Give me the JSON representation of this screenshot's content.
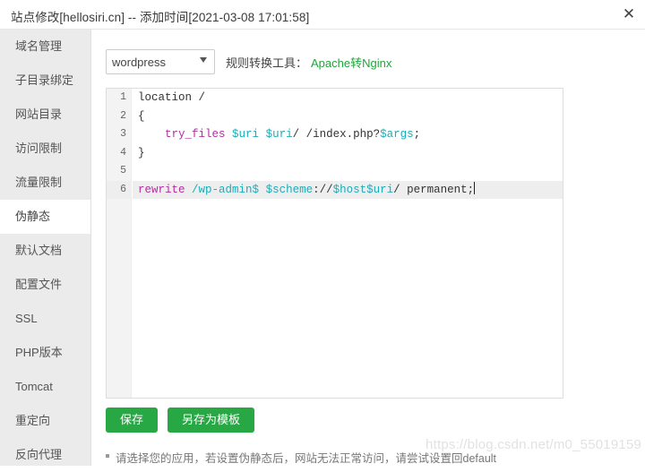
{
  "window": {
    "title": "站点修改[hellosiri.cn] -- 添加时间[2021-03-08 17:01:58]",
    "close_label": "✕"
  },
  "sidebar": {
    "items": [
      {
        "label": "域名管理",
        "active": false
      },
      {
        "label": "子目录绑定",
        "active": false
      },
      {
        "label": "网站目录",
        "active": false
      },
      {
        "label": "访问限制",
        "active": false
      },
      {
        "label": "流量限制",
        "active": false
      },
      {
        "label": "伪静态",
        "active": true
      },
      {
        "label": "默认文档",
        "active": false
      },
      {
        "label": "配置文件",
        "active": false
      },
      {
        "label": "SSL",
        "active": false
      },
      {
        "label": "PHP版本",
        "active": false
      },
      {
        "label": "Tomcat",
        "active": false
      },
      {
        "label": "重定向",
        "active": false
      },
      {
        "label": "反向代理",
        "active": false
      }
    ]
  },
  "toolbar": {
    "select_value": "wordpress",
    "select_options": [
      "wordpress"
    ],
    "converter_label": "规则转换工具：",
    "converter_link": "Apache转Nginx",
    "link_color": "#20a53a"
  },
  "editor": {
    "lines": [
      {
        "num": "1",
        "active": false,
        "tokens": [
          {
            "t": "location /",
            "c": "plain"
          }
        ]
      },
      {
        "num": "2",
        "active": false,
        "tokens": [
          {
            "t": "{",
            "c": "plain"
          }
        ]
      },
      {
        "num": "3",
        "active": false,
        "tokens": [
          {
            "t": "    ",
            "c": "plain"
          },
          {
            "t": "try_files",
            "c": "kw"
          },
          {
            "t": " ",
            "c": "plain"
          },
          {
            "t": "$uri",
            "c": "var"
          },
          {
            "t": " ",
            "c": "plain"
          },
          {
            "t": "$uri",
            "c": "var"
          },
          {
            "t": "/ /index.php?",
            "c": "plain"
          },
          {
            "t": "$args",
            "c": "var"
          },
          {
            "t": ";",
            "c": "plain"
          }
        ]
      },
      {
        "num": "4",
        "active": false,
        "tokens": [
          {
            "t": "}",
            "c": "plain"
          }
        ]
      },
      {
        "num": "5",
        "active": false,
        "tokens": [
          {
            "t": "",
            "c": "plain"
          }
        ]
      },
      {
        "num": "6",
        "active": true,
        "caret": true,
        "tokens": [
          {
            "t": "rewrite",
            "c": "kw"
          },
          {
            "t": " ",
            "c": "plain"
          },
          {
            "t": "/wp-admin$",
            "c": "var"
          },
          {
            "t": " ",
            "c": "plain"
          },
          {
            "t": "$scheme",
            "c": "var"
          },
          {
            "t": "://",
            "c": "plain"
          },
          {
            "t": "$host",
            "c": "var"
          },
          {
            "t": "$uri",
            "c": "var"
          },
          {
            "t": "/ permanent;",
            "c": "plain"
          }
        ]
      }
    ]
  },
  "actions": {
    "save_label": "保存",
    "save_template_label": "另存为模板",
    "button_color": "#28a745"
  },
  "footer": {
    "note": "请选择您的应用，若设置伪静态后，网站无法正常访问，请尝试设置回default"
  },
  "watermark": {
    "text": "https://blog.csdn.net/m0_55019159"
  }
}
